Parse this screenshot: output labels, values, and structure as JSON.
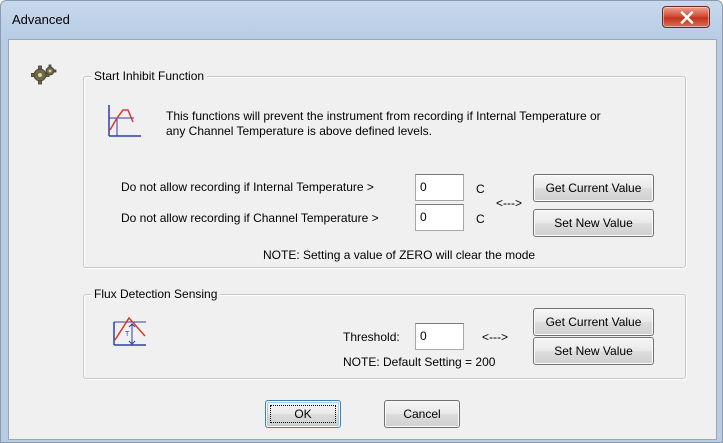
{
  "window": {
    "title": "Advanced"
  },
  "icons": {
    "window_icon": "gear-icon",
    "start_inhibit_graph": "temperature-graph-icon",
    "flux_graph": "flux-graph-icon",
    "close": "close-icon"
  },
  "start_inhibit": {
    "legend": "Start Inhibit Function",
    "description_line1": "This functions will prevent the instrument from recording if Internal Temperature or",
    "description_line2": "any Channel Temperature is above defined levels.",
    "internal_label": "Do not allow recording if Internal Temperature >",
    "internal_value": "0",
    "internal_unit": "C",
    "channel_label": "Do not allow recording if Channel Temperature >",
    "channel_value": "0",
    "channel_unit": "C",
    "arrow": "<--->",
    "get_button": "Get Current Value",
    "set_button": "Set New Value",
    "note": "NOTE: Setting a value of ZERO will clear the mode"
  },
  "flux": {
    "legend": "Flux Detection Sensing",
    "threshold_label": "Threshold:",
    "threshold_value": "0",
    "arrow": "<--->",
    "get_button": "Get Current Value",
    "set_button": "Set New Value",
    "note": "NOTE: Default Setting = 200"
  },
  "footer": {
    "ok_label": "OK",
    "cancel_label": "Cancel"
  },
  "colors": {
    "title_bar": "#bcd0e8",
    "client_bg": "#f0f0f0",
    "close_button": "#c2331c",
    "graph_red": "#d23a2a",
    "graph_blue": "#2a3fb0"
  }
}
